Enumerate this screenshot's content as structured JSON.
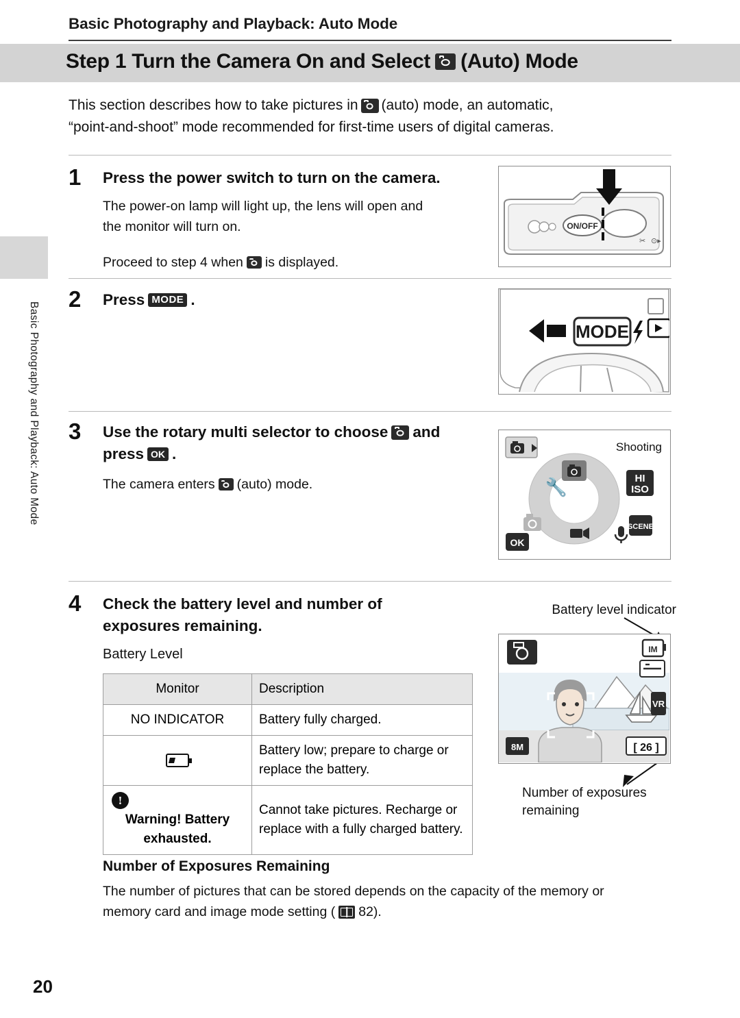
{
  "header": {
    "chapter": "Basic Photography and Playback: Auto Mode",
    "step_title_pre": "Step 1 Turn the Camera On and Select",
    "step_title_post": "(Auto) Mode"
  },
  "side_tab_text": "Basic Photography and Playback: Auto Mode",
  "intro": {
    "line1_a": "This section describes how to take pictures in",
    "line1_b": "(auto) mode, an automatic,",
    "line2": "“point-and-shoot” mode recommended for first-time users of digital cameras."
  },
  "steps": [
    {
      "num": "1",
      "heading": "Press the power switch to turn on the camera.",
      "body_line1": "The power-on lamp will light up, the lens will open and",
      "body_line2": "the monitor will turn on.",
      "body_line3_a": "Proceed to step 4 when",
      "body_line3_b": "is displayed."
    },
    {
      "num": "2",
      "heading_a": "Press",
      "heading_icon": "MODE",
      "heading_b": "."
    },
    {
      "num": "3",
      "heading_a": "Use the rotary multi selector to choose",
      "heading_b": "and",
      "heading_c": "press",
      "heading_ok": "OK",
      "heading_d": ".",
      "body_a": "The camera enters",
      "body_b": "(auto) mode."
    },
    {
      "num": "4",
      "heading_line1": "Check the battery level and number of",
      "heading_line2": "exposures remaining.",
      "subhead1": "Battery Level",
      "subhead2": "Number of Exposures Remaining",
      "closing_line1": "The number of pictures that can be stored depends on the capacity of the memory or",
      "closing_line2_a": "memory card and image mode setting (",
      "closing_line2_b": "82)."
    }
  ],
  "battery_table": {
    "headers": [
      "Monitor",
      "Description"
    ],
    "rows": [
      {
        "monitor_text": "NO INDICATOR",
        "monitor_icon": "",
        "description": "Battery fully charged."
      },
      {
        "monitor_text": "",
        "monitor_icon": "battery-low-icon",
        "description": "Battery low; prepare to charge or replace the battery."
      },
      {
        "monitor_text": "Warning! Battery exhausted.",
        "monitor_icon": "warning-icon",
        "description": "Cannot take pictures. Recharge or replace with a fully charged battery."
      }
    ]
  },
  "figures": {
    "fig1": {
      "name": "camera-power-switch-illustration",
      "button_label": "ON/OFF"
    },
    "fig2": {
      "name": "camera-mode-button-illustration",
      "mode_label": "MODE"
    },
    "fig3": {
      "name": "shooting-mode-menu-screen",
      "title": "Shooting",
      "ok_label": "OK",
      "iso_label_top": "HI",
      "iso_label_bottom": "ISO",
      "scene_label": "SCENE"
    },
    "fig4": {
      "name": "monitor-battery-and-exposures-screen",
      "label_top": "Battery level indicator",
      "label_bottom_line1": "Number of exposures",
      "label_bottom_line2": "remaining",
      "image_mode_badge": "8M",
      "exposures_value": "26",
      "vr_badge": "VR",
      "macro_badge": "IM"
    }
  },
  "page_number": "20",
  "colors": {
    "band": "#d3d3d3",
    "rule": "#b9b9b9",
    "table_header": "#e6e6e6",
    "text": "#111111"
  }
}
